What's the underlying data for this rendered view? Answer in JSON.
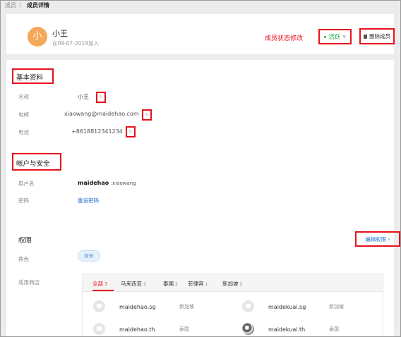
{
  "breadcrumb": {
    "parent": "成员",
    "separator": "〉",
    "current": "成员详情"
  },
  "member": {
    "avatar_text": "小",
    "name": "小王",
    "joined": "在09-07-2019加入",
    "status_change_label": "成员状态修改",
    "status": "活跃",
    "delete_label": "删除成员"
  },
  "basic": {
    "title": "基本资料",
    "name_label": "名称",
    "name_value": "小王",
    "email_label": "电邮",
    "email_value": "xiaowang@maidehao.com",
    "phone_label": "电话",
    "phone_value": "+8618812341234"
  },
  "account": {
    "title": "帐户与安全",
    "username_label": "用户名",
    "username_prefix": "maidehao",
    "username_suffix": ":xiaowang",
    "password_label": "密码",
    "reset_password": "重设密码"
  },
  "permissions": {
    "title": "权限",
    "edit_label": "编辑权限",
    "role_label": "角色",
    "role_value": "财务",
    "stores_label": "适用商店",
    "tabs": [
      {
        "label": "全部",
        "count": "7"
      },
      {
        "label": "马来西亚",
        "count": "2"
      },
      {
        "label": "泰国",
        "count": "2"
      },
      {
        "label": "菲律宾",
        "count": "1"
      },
      {
        "label": "新加坡",
        "count": "2"
      }
    ],
    "stores": [
      {
        "name": "maidehao.sg",
        "country": "新加坡"
      },
      {
        "name": "maidekuai.sg",
        "country": "新加坡"
      },
      {
        "name": "maidehao.th",
        "country": "泰国"
      },
      {
        "name": "maidekuai.th",
        "country": "泰国"
      }
    ]
  }
}
